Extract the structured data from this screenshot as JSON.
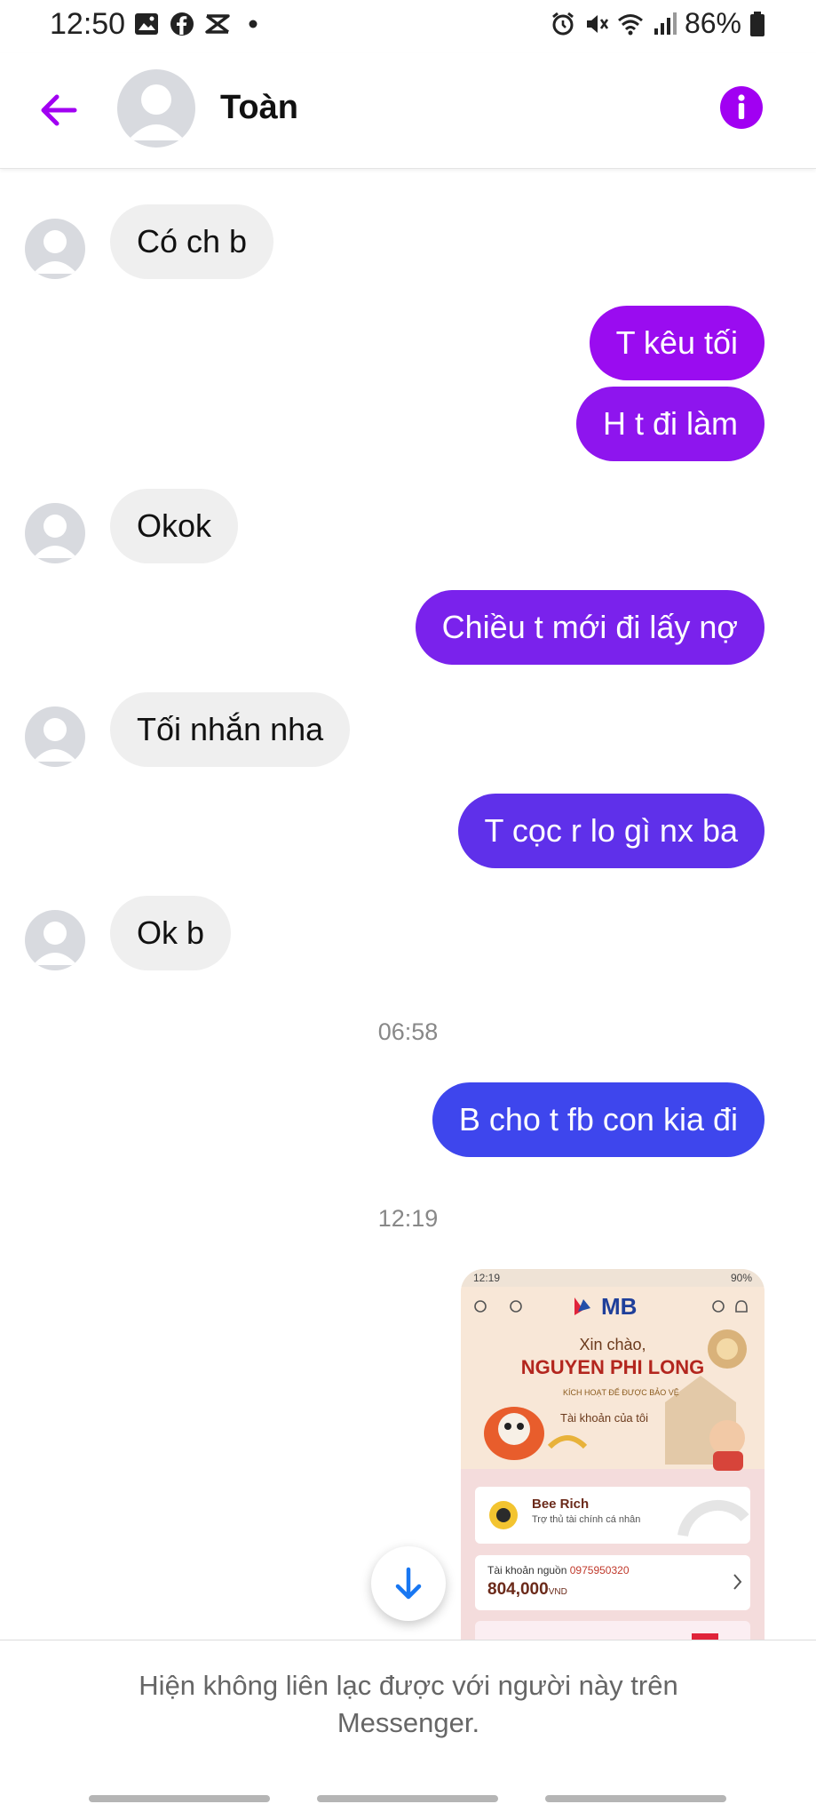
{
  "status_bar": {
    "time": "12:50",
    "battery": "86%",
    "icons_left": [
      "gallery-icon",
      "facebook-icon",
      "capcut-icon",
      "dot-icon"
    ],
    "icons_right": [
      "alarm-icon",
      "mute-icon",
      "wifi-icon",
      "signal-icon",
      "battery-icon"
    ]
  },
  "header": {
    "contact_name": "Toàn",
    "accent_color": "#a100f2"
  },
  "messages": [
    {
      "dir": "in",
      "text": "Có ch b"
    },
    {
      "dir": "out",
      "text": "T kêu tối",
      "color": "#9a0cf0"
    },
    {
      "dir": "out",
      "text": "H t đi làm",
      "color": "#8e15ee"
    },
    {
      "dir": "in",
      "text": "Okok"
    },
    {
      "dir": "out",
      "text": "Chiều t mới đi lấy nợ",
      "color": "#7a22ec"
    },
    {
      "dir": "in",
      "text": "Tối nhắn nha"
    },
    {
      "dir": "out",
      "text": "T cọc r lo gì nx ba",
      "color": "#5f30ea"
    },
    {
      "dir": "in",
      "text": "Ok b"
    },
    {
      "dir": "timestamp",
      "text": "06:58"
    },
    {
      "dir": "out",
      "text": "B cho t fb con kia đi",
      "color": "#3e46ed"
    },
    {
      "dir": "timestamp",
      "text": "12:19"
    }
  ],
  "shared_image": {
    "status_time": "12:19",
    "status_batt": "90%",
    "bank": "MB",
    "greeting": "Xin chào,",
    "user_name": "NGUYEN PHI LONG",
    "activation": "KÍCH HOẠT ĐỂ ĐƯỢC BẢO VỆ",
    "my_account": "Tài khoản của tôi",
    "bee_title": "Bee Rich",
    "bee_sub": "Trợ thủ tài chính cá nhân",
    "src_label": "Tài khoản nguồn",
    "acct_no": "0975950320",
    "balance": "804,000",
    "currency": "VND"
  },
  "footer": {
    "notice": "Hiện không liên lạc được với người này trên Messenger."
  }
}
